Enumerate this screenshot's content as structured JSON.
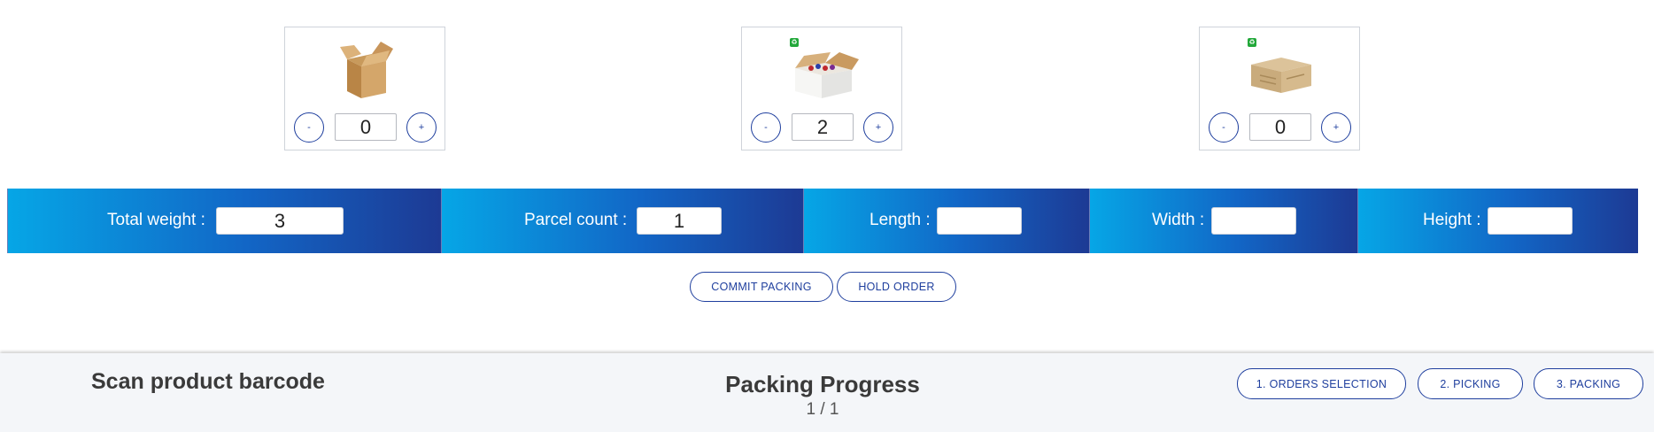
{
  "boxes": [
    {
      "name": "open-brown-box",
      "quantity": "0",
      "minus_label": "-",
      "plus_label": "+",
      "eco_badge": false
    },
    {
      "name": "white-box-with-bottles",
      "quantity": "2",
      "minus_label": "-",
      "plus_label": "+",
      "eco_badge": true
    },
    {
      "name": "closed-carton-box",
      "quantity": "0",
      "minus_label": "-",
      "plus_label": "+",
      "eco_badge": true
    }
  ],
  "fields": {
    "total_weight": {
      "label": "Total weight :",
      "value": "3"
    },
    "parcel_count": {
      "label": "Parcel count :",
      "value": "1"
    },
    "length": {
      "label": "Length :",
      "value": ""
    },
    "width": {
      "label": "Width :",
      "value": ""
    },
    "height": {
      "label": "Height :",
      "value": ""
    }
  },
  "actions": {
    "commit": "COMMIT PACKING",
    "hold": "HOLD ORDER"
  },
  "footer": {
    "scan_title": "Scan product barcode",
    "progress_title": "Packing Progress",
    "progress_count": "1 / 1",
    "steps": [
      "1. ORDERS SELECTION",
      "2. PICKING",
      "3. PACKING"
    ]
  },
  "colors": {
    "accent": "#1f3f9e",
    "gradient_start": "#06a6e6",
    "gradient_end": "#1d3a94",
    "footer_bg": "#f4f6f9",
    "eco_badge": "#22a83a"
  }
}
